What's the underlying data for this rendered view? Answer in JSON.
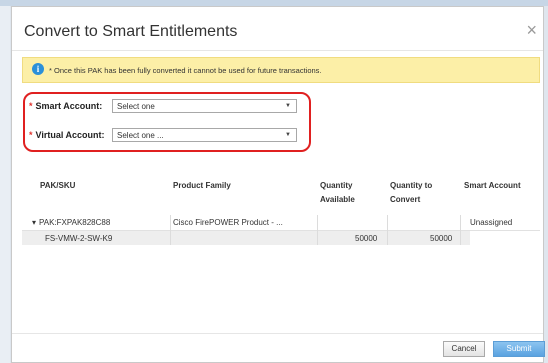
{
  "dialog": {
    "title": "Convert to Smart Entitlements",
    "close_glyph": "×"
  },
  "notice": {
    "icon": "info-icon",
    "text": "* Once this PAK has been fully converted it cannot be used for future transactions."
  },
  "form": {
    "smart_account_label": "Smart Account:",
    "smart_account_value": "Select one",
    "virtual_account_label": "Virtual Account:",
    "virtual_account_value": "Select one ...",
    "required_marker": "*",
    "caret_glyph": "▼"
  },
  "table": {
    "headers": {
      "pak_sku": "PAK/SKU",
      "product_family": "Product Family",
      "quantity_available": "Quantity Available",
      "quantity_to_convert": "Quantity to Convert",
      "smart_account": "Smart Account"
    },
    "rows": [
      {
        "expand_glyph": "▾",
        "pak_sku": "PAK:FXPAK828C88",
        "product_family": "Cisco FirePOWER Product - ...",
        "quantity_available": "",
        "quantity_to_convert": "",
        "smart_account": "Unassigned"
      },
      {
        "pak_sku": "FS-VMW-2-SW-K9",
        "product_family": "",
        "quantity_available": "50000",
        "quantity_to_convert": "50000",
        "smart_account": ""
      }
    ]
  },
  "footer": {
    "cancel_label": "Cancel",
    "submit_label": "Submit"
  },
  "colors": {
    "required": "#e0322d",
    "highlight": "#e02020",
    "notice_bg": "#fcefa7",
    "submit_bg": "#5aa2e0"
  }
}
